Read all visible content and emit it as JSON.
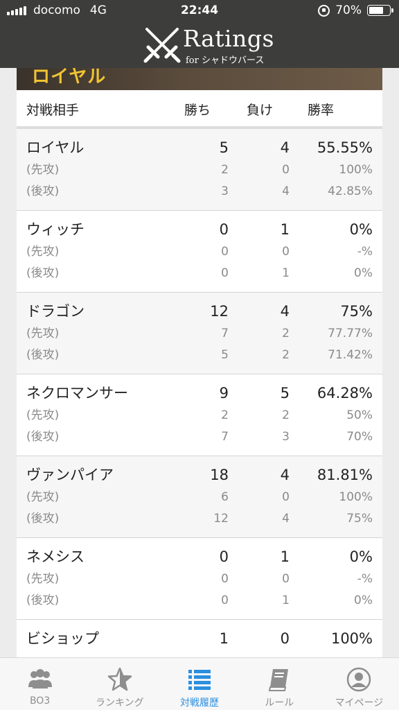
{
  "status_bar": {
    "carrier": "docomo",
    "network": "4G",
    "time": "22:44",
    "battery": "70%",
    "battery_level": 0.7
  },
  "brand": {
    "title": "Ratings",
    "subtitle": "for シャドウバース"
  },
  "banner": {
    "text": "ロイヤル"
  },
  "table": {
    "headers": {
      "opponent": "対戦相手",
      "wins": "勝ち",
      "losses": "負け",
      "rate": "勝率"
    },
    "groups": [
      {
        "name": "ロイヤル",
        "wins": "5",
        "losses": "4",
        "rate": "55.55%",
        "first": {
          "label": "(先攻)",
          "wins": "2",
          "losses": "0",
          "rate": "100%"
        },
        "second": {
          "label": "(後攻)",
          "wins": "3",
          "losses": "4",
          "rate": "42.85%"
        }
      },
      {
        "name": "ウィッチ",
        "wins": "0",
        "losses": "1",
        "rate": "0%",
        "first": {
          "label": "(先攻)",
          "wins": "0",
          "losses": "0",
          "rate": "-%"
        },
        "second": {
          "label": "(後攻)",
          "wins": "0",
          "losses": "1",
          "rate": "0%"
        }
      },
      {
        "name": "ドラゴン",
        "wins": "12",
        "losses": "4",
        "rate": "75%",
        "first": {
          "label": "(先攻)",
          "wins": "7",
          "losses": "2",
          "rate": "77.77%"
        },
        "second": {
          "label": "(後攻)",
          "wins": "5",
          "losses": "2",
          "rate": "71.42%"
        }
      },
      {
        "name": "ネクロマンサー",
        "wins": "9",
        "losses": "5",
        "rate": "64.28%",
        "first": {
          "label": "(先攻)",
          "wins": "2",
          "losses": "2",
          "rate": "50%"
        },
        "second": {
          "label": "(後攻)",
          "wins": "7",
          "losses": "3",
          "rate": "70%"
        }
      },
      {
        "name": "ヴァンパイア",
        "wins": "18",
        "losses": "4",
        "rate": "81.81%",
        "first": {
          "label": "(先攻)",
          "wins": "6",
          "losses": "0",
          "rate": "100%"
        },
        "second": {
          "label": "(後攻)",
          "wins": "12",
          "losses": "4",
          "rate": "75%"
        }
      },
      {
        "name": "ネメシス",
        "wins": "0",
        "losses": "1",
        "rate": "0%",
        "first": {
          "label": "(先攻)",
          "wins": "0",
          "losses": "0",
          "rate": "-%"
        },
        "second": {
          "label": "(後攻)",
          "wins": "0",
          "losses": "1",
          "rate": "0%"
        }
      },
      {
        "name": "ビショップ",
        "wins": "1",
        "losses": "0",
        "rate": "100%"
      }
    ]
  },
  "tabs": [
    {
      "label": "BO3",
      "icon": "group-icon",
      "active": false
    },
    {
      "label": "ランキング",
      "icon": "star-icon",
      "active": false
    },
    {
      "label": "対戦履歴",
      "icon": "list-icon",
      "active": true
    },
    {
      "label": "ルール",
      "icon": "book-icon",
      "active": false
    },
    {
      "label": "マイページ",
      "icon": "user-circle-icon",
      "active": false
    }
  ],
  "colors": {
    "header_bg": "#3d3d3b",
    "accent": "#2b8fe0",
    "banner_text": "#f0c432"
  }
}
